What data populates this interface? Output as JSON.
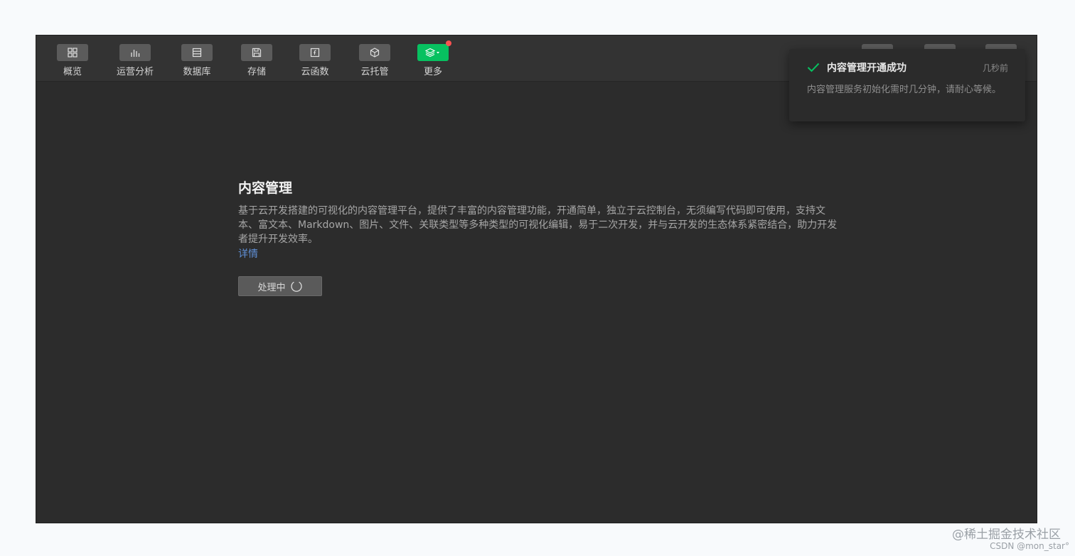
{
  "toolbar": {
    "items": [
      {
        "label": "概览",
        "icon": "grid-icon"
      },
      {
        "label": "运营分析",
        "icon": "bar-chart-icon"
      },
      {
        "label": "数据库",
        "icon": "database-icon"
      },
      {
        "label": "存储",
        "icon": "save-icon"
      },
      {
        "label": "云函数",
        "icon": "function-icon"
      },
      {
        "label": "云托管",
        "icon": "cube-icon"
      },
      {
        "label": "更多",
        "icon": "layers-icon"
      }
    ],
    "more_active_color": "#07c160",
    "badge_color": "#fa5151"
  },
  "main": {
    "title": "内容管理",
    "description": "基于云开发搭建的可视化的内容管理平台，提供了丰富的内容管理功能，开通简单，独立于云控制台，无须编写代码即可使用，支持文本、富文本、Markdown、图片、文件、关联类型等多种类型的可视化编辑，易于二次开发，并与云开发的生态体系紧密结合，助力开发者提升开发效率。",
    "detail_link": "详情",
    "processing_button": "处理中"
  },
  "toast": {
    "title": "内容管理开通成功",
    "time": "几秒前",
    "body": "内容管理服务初始化需时几分钟，请耐心等候。",
    "check_color": "#07c160"
  },
  "watermark": {
    "line1": "@稀土掘金技术社区",
    "line2": "CSDN @mon_star°"
  }
}
